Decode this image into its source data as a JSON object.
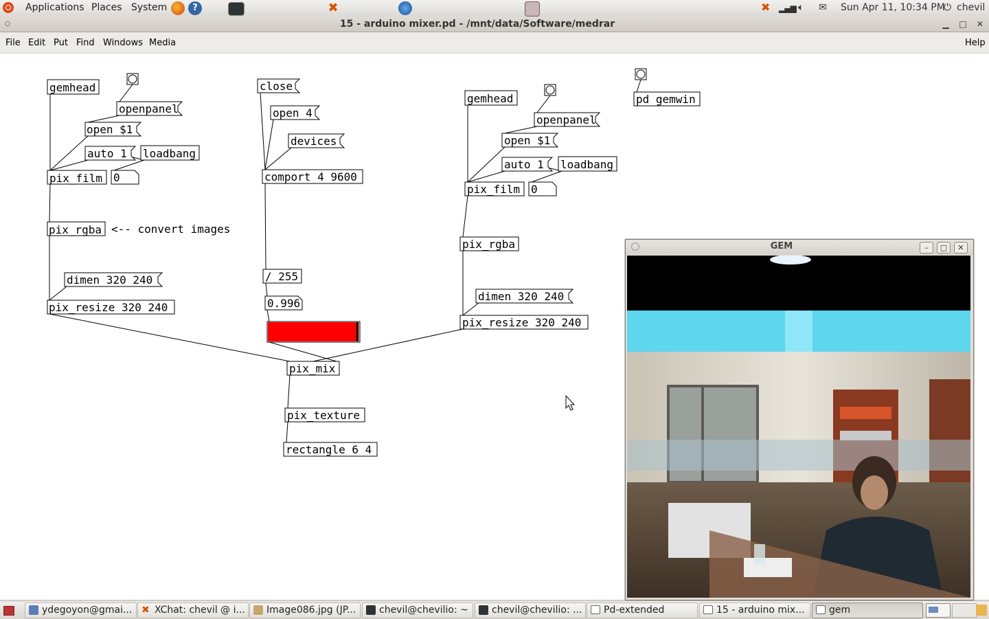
{
  "top_panel": {
    "applications": "Applications",
    "places": "Places",
    "system": "System",
    "clock": "Sun Apr 11, 10:34 PM",
    "user": "chevil"
  },
  "window": {
    "title": "15 - arduino mixer.pd  - /mnt/data/Software/medrar"
  },
  "menubar": {
    "file": "File",
    "edit": "Edit",
    "put": "Put",
    "find": "Find",
    "windows": "Windows",
    "media": "Media",
    "help": "Help"
  },
  "patch": {
    "gemhead_1": "gemhead",
    "openpanel_1": "openpanel",
    "open_1": "open $1",
    "auto_1": "auto 1",
    "loadbang_1": "loadbang",
    "pix_film_1": "pix_film",
    "num_film_1": "0",
    "pix_rgba_1": "pix_rgba",
    "comment_convert": "<-- convert images",
    "dimen_1": "dimen 320 240",
    "pix_resize_1": "pix_resize 320 240",
    "close": "close",
    "open_4": "open 4",
    "devices": "devices",
    "comport": "comport 4 9600",
    "div_255": "/ 255",
    "num_value": "0.996",
    "slider_level": 0.996,
    "slider_color": "#ff0000",
    "pix_mix": "pix_mix",
    "pix_texture": "pix_texture",
    "rectangle": "rectangle 6 4",
    "gemhead_2": "gemhead",
    "openpanel_2": "openpanel",
    "open_2": "open $1",
    "auto_2": "auto 1",
    "loadbang_2": "loadbang",
    "pix_film_2": "pix_film",
    "num_film_2": "0",
    "pix_rgba_2": "pix_rgba",
    "dimen_2": "dimen 320 240",
    "pix_resize_2": "pix_resize 320 240",
    "pd_gemwin": "pd gemwin"
  },
  "gem_window": {
    "title": "GEM"
  },
  "taskbar": {
    "items": [
      {
        "label": "ydegoyon@gmai..."
      },
      {
        "label": "XChat: chevil @ i..."
      },
      {
        "label": "Image086.jpg (JP..."
      },
      {
        "label": "chevil@chevilio: ~"
      },
      {
        "label": "chevil@chevilio: ..."
      },
      {
        "label": "Pd-extended"
      },
      {
        "label": "15 - arduino mix..."
      },
      {
        "label": "gem"
      }
    ]
  }
}
